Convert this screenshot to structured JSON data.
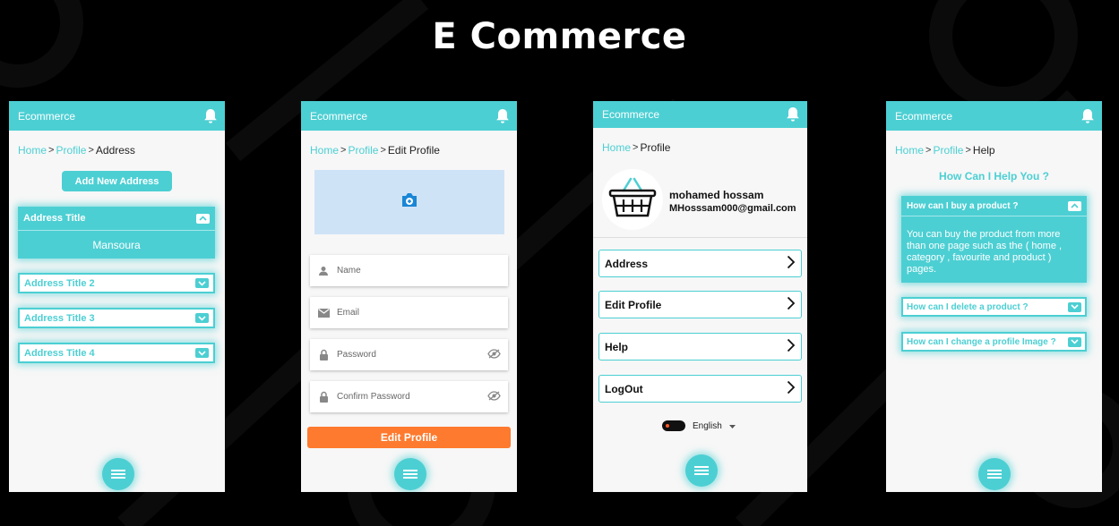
{
  "page": {
    "title": "E Commerce"
  },
  "colors": {
    "accent": "#4ccfd3",
    "orange": "#fe7a2e",
    "background": "#000000"
  },
  "common": {
    "app_title": "Ecommerce",
    "home": "Home",
    "profile": "Profile",
    "sep": ">"
  },
  "screen_address": {
    "crumb_current": "Address",
    "add_button": "Add New Address",
    "expanded": {
      "title": "Address Title",
      "body": "Mansoura"
    },
    "collapsed": [
      "Address Title 2",
      "Address Title 3",
      "Address Title 4"
    ]
  },
  "screen_edit": {
    "crumb_current": "Edit Profile",
    "placeholders": {
      "name": "Name",
      "email": "Email",
      "password": "Password",
      "confirm": "Confirm Password"
    },
    "submit": "Edit Profile"
  },
  "screen_profile": {
    "name": "mohamed hossam",
    "email": "MHosssam000@gmail.com",
    "menu": [
      "Address",
      "Edit Profile",
      "Help",
      "LogOut"
    ],
    "language": "English"
  },
  "screen_help": {
    "crumb_current": "Help",
    "heading": "How Can I Help You ?",
    "open_question": "How can I buy a product ?",
    "open_answer": "You can buy the product from more than one page such as the ( home , category , favourite and product ) pages.",
    "closed_questions": [
      "How can I delete a product ?",
      "How can I change a profile Image ?"
    ]
  },
  "icons": [
    "bell-icon",
    "menu-icon",
    "chevron-up-icon",
    "chevron-down-icon",
    "camera-icon",
    "person-icon",
    "email-icon",
    "lock-icon",
    "eye-off-icon",
    "chevron-right-icon",
    "basket-icon",
    "toggle-icon",
    "dropdown-arrow-icon"
  ]
}
